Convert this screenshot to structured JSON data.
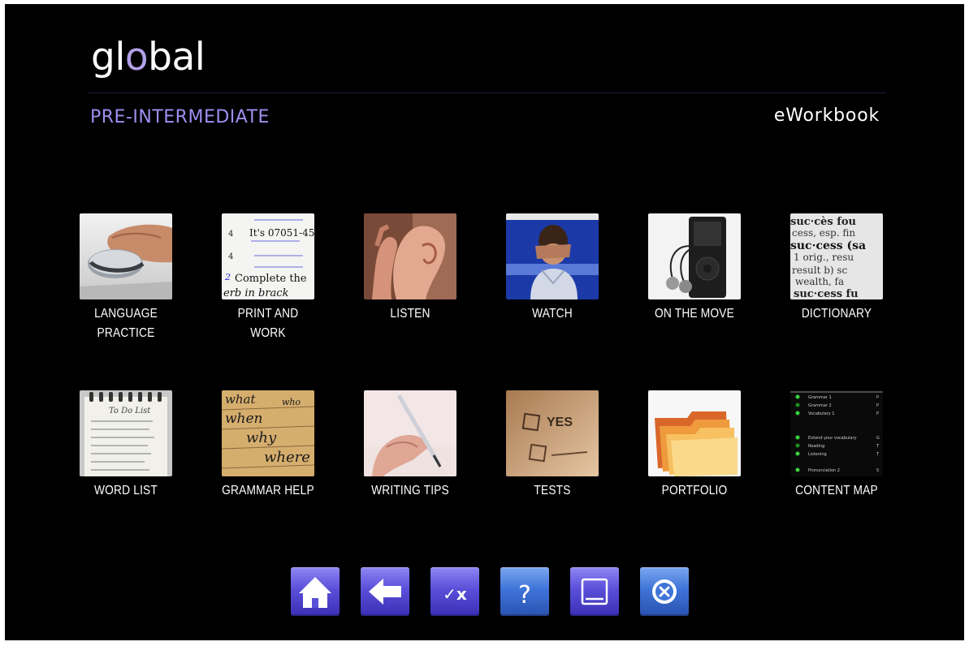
{
  "app": {
    "logo_prefix": "gl",
    "logo_accent": "o",
    "logo_suffix": "bal",
    "level": "PRE-INTERMEDIATE",
    "product": "eWorkbook"
  },
  "colors": {
    "background": "#000000",
    "logo_accent": "#b0a0e6",
    "level_text": "#9d8ff0",
    "button_purple": "#5a4fd8",
    "button_blue": "#3f74d8"
  },
  "menu": {
    "row1": [
      {
        "label_line1": "LANGUAGE",
        "label_line2": "PRACTICE",
        "icon": "mouse-hand-photo"
      },
      {
        "label_line1": "PRINT AND",
        "label_line2": "WORK",
        "icon": "printed-worksheet-photo"
      },
      {
        "label_line1": "LISTEN",
        "label_line2": "",
        "icon": "ear-listening-photo"
      },
      {
        "label_line1": "WATCH",
        "label_line2": "",
        "icon": "person-watching-screen-photo"
      },
      {
        "label_line1": "ON THE MOVE",
        "label_line2": "",
        "icon": "mp3-player-photo"
      },
      {
        "label_line1": "DICTIONARY",
        "label_line2": "",
        "icon": "dictionary-page-photo"
      }
    ],
    "row2": [
      {
        "label_line1": "WORD LIST",
        "icon": "to-do-list-notepad-photo"
      },
      {
        "label_line1": "GRAMMAR HELP",
        "icon": "question-words-photo"
      },
      {
        "label_line1": "WRITING TIPS",
        "icon": "hand-writing-pen-photo"
      },
      {
        "label_line1": "TESTS",
        "icon": "yes-no-checkbox-photo"
      },
      {
        "label_line1": "PORTFOLIO",
        "icon": "folders-photo"
      },
      {
        "label_line1": "CONTENT MAP",
        "icon": "content-map-list-image"
      }
    ]
  },
  "content_map_preview": {
    "items": [
      "Grammar 1",
      "Grammar 2",
      "Vocabulary 1",
      "Extend your vocabulary",
      "Reading",
      "Listening",
      "Pronunciation 2"
    ]
  },
  "thumbnail_text": {
    "print_and_work": [
      "It's 07051-45",
      "Complete the",
      "erb in brack"
    ],
    "dictionary": [
      "suc·cès fou",
      "cess, esp. fin",
      "suc·cess (sa",
      "1 orig., resu",
      "result b) sc",
      "wealth, fa",
      "suc·cess fu"
    ],
    "word_list_title": "To Do List",
    "grammar_words": [
      "what",
      "when",
      "why",
      "where",
      "who"
    ],
    "tests_word": "YES"
  },
  "toolbar": [
    {
      "name": "home",
      "icon": "home-icon"
    },
    {
      "name": "back",
      "icon": "back-arrow-icon"
    },
    {
      "name": "check-answers",
      "icon": "check-cross-icon",
      "symbol": "✓x"
    },
    {
      "name": "help",
      "icon": "question-mark-icon",
      "symbol": "?"
    },
    {
      "name": "minimize",
      "icon": "minimize-window-icon"
    },
    {
      "name": "close",
      "icon": "close-circle-icon"
    }
  ]
}
